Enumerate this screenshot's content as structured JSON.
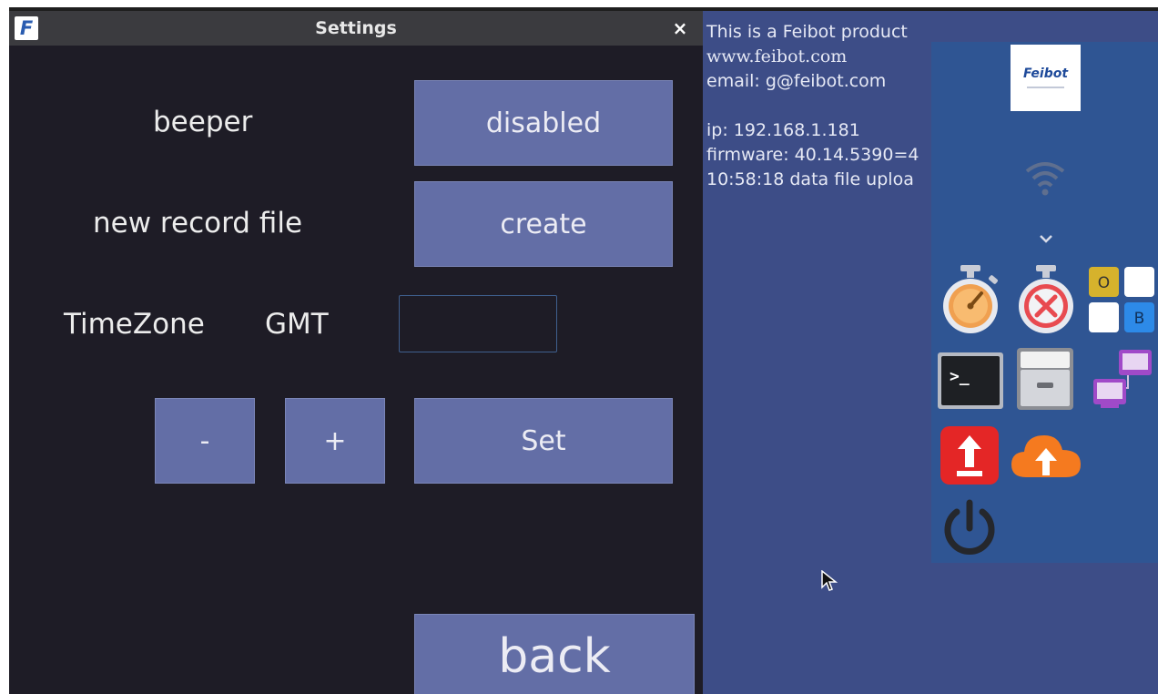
{
  "window": {
    "title": "Settings",
    "logo_letter": "F",
    "close_symbol": "×"
  },
  "settings": {
    "beeper_label": "beeper",
    "beeper_value": "disabled",
    "record_label": "new record file",
    "record_button": "create",
    "timezone_label": "TimeZone",
    "gmt_label": "GMT",
    "timezone_value": "",
    "minus_label": "-",
    "plus_label": "+",
    "set_label": "Set",
    "back_label": "back"
  },
  "info": {
    "line1": "This is a Feibot product",
    "line2": "www.feibot.com",
    "line3": "email: g@feibot.com",
    "line4": "ip: 192.168.1.181",
    "line5": "firmware: 40.14.5390=4",
    "line6": "10:58:18 data file uploa"
  },
  "dock": {
    "logo_text": "Feibot",
    "icons": [
      "wifi-icon",
      "chevron-down-icon",
      "stopwatch-icon",
      "stopwatch-cancel-icon",
      "ob-grid-icon",
      "terminal-icon",
      "file-cabinet-icon",
      "network-icon",
      "upload-icon",
      "cloud-upload-icon",
      "power-icon"
    ],
    "tile_letter_o": "O",
    "tile_letter_b": "B",
    "terminal_prompt": ">_"
  },
  "colors": {
    "button": "#636ea6",
    "window_bg": "#1e1c26",
    "desktop_bg": "#3d4d87",
    "dock_bg": "#2f5593"
  }
}
